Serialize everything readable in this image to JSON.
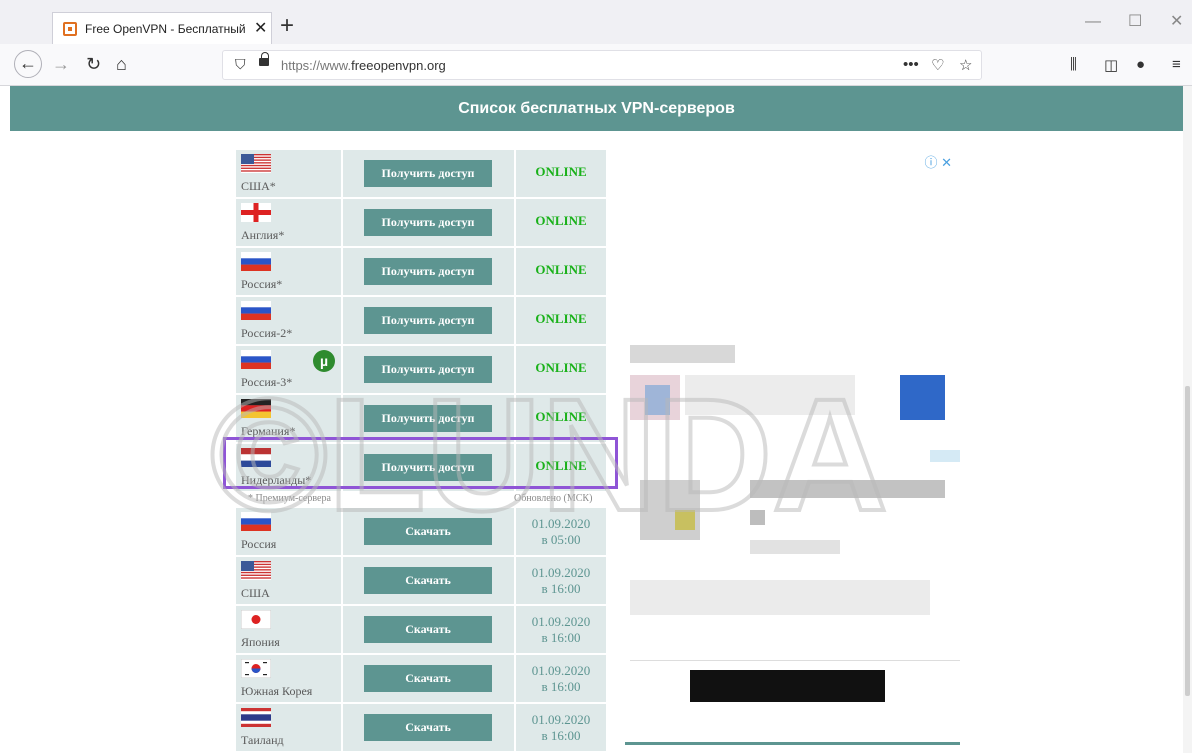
{
  "browser": {
    "tab_title": "Free OpenVPN - Бесплатный",
    "url_prefix": "https://www.",
    "url_domain": "freeopenvpn.org"
  },
  "page": {
    "title": "Список бесплатных VPN-серверов"
  },
  "colors": {
    "header": "#5d9591",
    "online": "#1ab11a",
    "highlight": "#8f55d6"
  },
  "servers_premium": [
    {
      "country": "США*",
      "button": "Получить доступ",
      "status": "ONLINE",
      "flag": "us"
    },
    {
      "country": "Англия*",
      "button": "Получить доступ",
      "status": "ONLINE",
      "flag": "en"
    },
    {
      "country": "Россия*",
      "button": "Получить доступ",
      "status": "ONLINE",
      "flag": "ru"
    },
    {
      "country": "Россия-2*",
      "button": "Получить доступ",
      "status": "ONLINE",
      "flag": "ru"
    },
    {
      "country": "Россия-3*",
      "button": "Получить доступ",
      "status": "ONLINE",
      "flag": "ru"
    },
    {
      "country": "Германия*",
      "button": "Получить доступ",
      "status": "ONLINE",
      "flag": "de"
    },
    {
      "country": "Нидерланды*",
      "button": "Получить доступ",
      "status": "ONLINE",
      "flag": "nl"
    }
  ],
  "notes": {
    "premium": "* Премиум-сервера",
    "updated": "Обновлено (МСК)"
  },
  "servers_free": [
    {
      "country": "Россия",
      "button": "Скачать",
      "date": "01.09.2020",
      "time": "в 05:00",
      "flag": "ru"
    },
    {
      "country": "США",
      "button": "Скачать",
      "date": "01.09.2020",
      "time": "в 16:00",
      "flag": "us"
    },
    {
      "country": "Япония",
      "button": "Скачать",
      "date": "01.09.2020",
      "time": "в 16:00",
      "flag": "jp"
    },
    {
      "country": "Южная Корея",
      "button": "Скачать",
      "date": "01.09.2020",
      "time": "в 16:00",
      "flag": "kr"
    },
    {
      "country": "Таиланд",
      "button": "Скачать",
      "date": "01.09.2020",
      "time": "в 16:00",
      "flag": "th"
    }
  ],
  "watermark": "©LUNDA"
}
